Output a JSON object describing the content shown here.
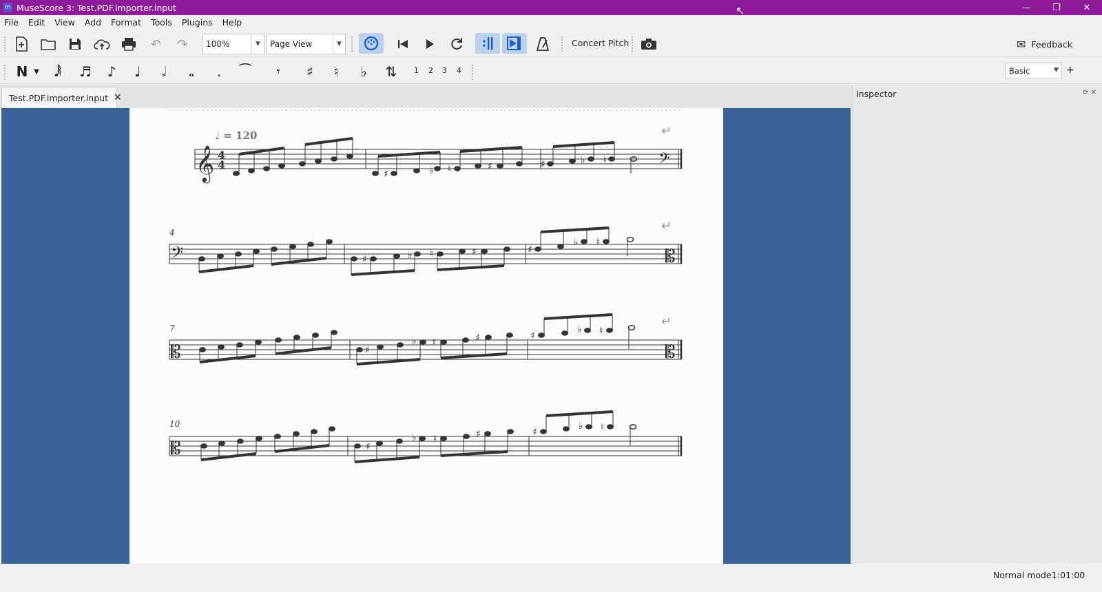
{
  "window": {
    "app_icon": "musescore-icon",
    "title": "MuseScore 3: Test.PDF.importer.input",
    "minimize": "—",
    "maximize": "❐",
    "close": "✕"
  },
  "menu": [
    "File",
    "Edit",
    "View",
    "Add",
    "Format",
    "Tools",
    "Plugins",
    "Help"
  ],
  "toolbar": {
    "zoom": "100%",
    "view_mode": "Page View",
    "concert_pitch": "Concert Pitch",
    "feedback": "Feedback"
  },
  "note_toolbar": {
    "voices": [
      "1",
      "2",
      "3",
      "4"
    ],
    "workspace": "Basic",
    "add": "+"
  },
  "tab": {
    "label": "Test.PDF.importer.input",
    "close": "✕"
  },
  "score": {
    "tempo": "♩ = 120",
    "measure_numbers": [
      "4",
      "7",
      "10"
    ]
  },
  "inspector": {
    "title": "Inspector"
  },
  "status": {
    "mode": "Normal mode",
    "time": "1:01:00"
  },
  "colors": {
    "titlebar": "#8e1a99",
    "score_background": "#3a6296",
    "page": "#fbfbfb",
    "active_button": "#bcd2ec"
  }
}
